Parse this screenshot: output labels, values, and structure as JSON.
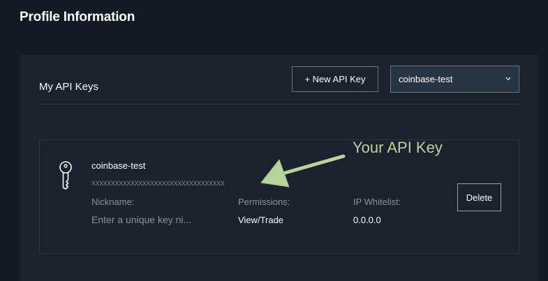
{
  "header": {
    "title": "Profile Information"
  },
  "api_keys": {
    "title": "My API Keys",
    "new_key_label": "+ New API Key",
    "selected_key": "coinbase-test",
    "card": {
      "name": "coinbase-test",
      "key_value": "xxxxxxxxxxxxxxxxxxxxxxxxxxxxxxxxxx",
      "nickname_label": "Nickname:",
      "nickname_placeholder": "Enter a unique key ni...",
      "permissions_label": "Permissions:",
      "permissions_value": "View/Trade",
      "ip_whitelist_label": "IP Whitelist:",
      "ip_whitelist_value": "0.0.0.0",
      "delete_label": "Delete"
    }
  },
  "annotation": {
    "text": "Your API Key",
    "color": "#b8d49a"
  },
  "icons": {
    "key": "key-icon",
    "select": "chevron-down-icon"
  },
  "colors": {
    "background": "#121a24",
    "panel": "#19222d",
    "select_background": "#273444"
  }
}
